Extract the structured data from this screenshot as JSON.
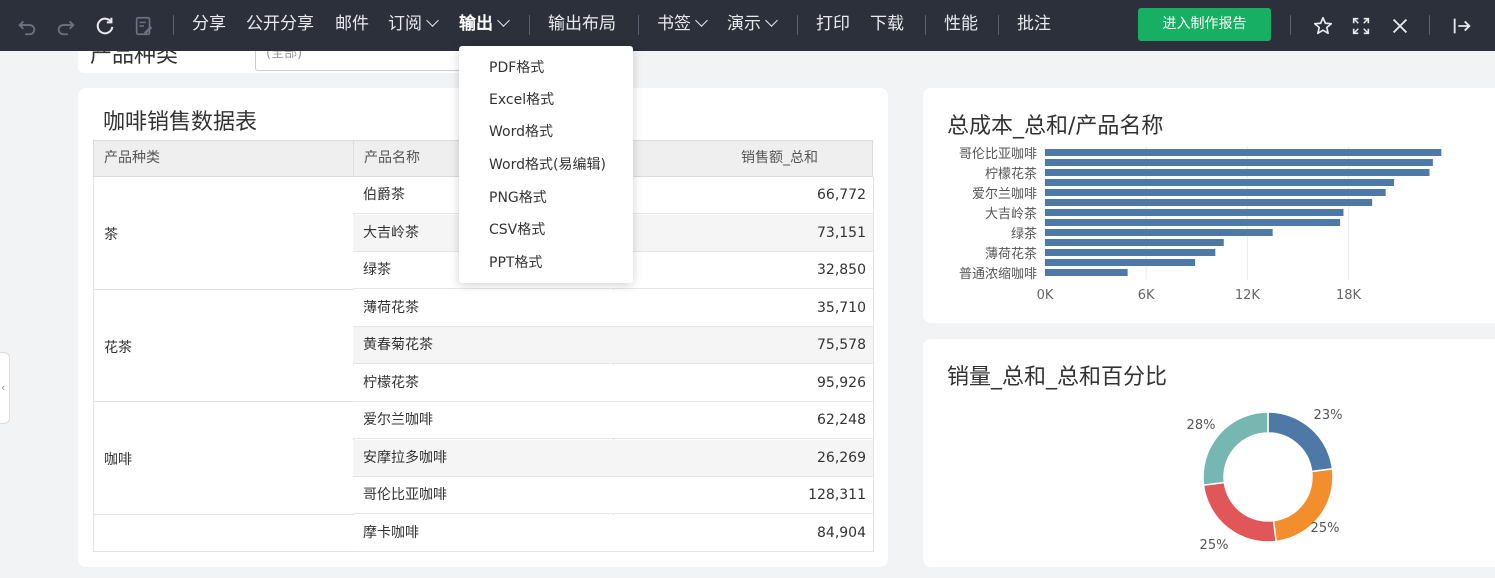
{
  "toolbar": {
    "items": [
      "分享",
      "公开分享",
      "邮件",
      "订阅",
      "输出",
      "输出布局",
      "书签",
      "演示",
      "打印",
      "下载",
      "性能",
      "批注"
    ],
    "active_index": 4,
    "cta_label": "进入制作报告"
  },
  "filter": {
    "label": "产品种类",
    "value": "(全部)"
  },
  "export_menu": {
    "items": [
      "PDF格式",
      "Excel格式",
      "Word格式",
      "Word格式(易编辑)",
      "PNG格式",
      "CSV格式",
      "PPT格式"
    ]
  },
  "sales_table": {
    "title": "咖啡销售数据表",
    "headers": [
      "产品种类",
      "产品名称",
      "",
      "销售额_总和"
    ],
    "groups": [
      {
        "category": "茶",
        "rows": [
          {
            "name": "伯爵茶",
            "value": "66,772"
          },
          {
            "name": "大吉岭茶",
            "value": "73,151"
          },
          {
            "name": "绿茶",
            "value": "32,850"
          }
        ]
      },
      {
        "category": "花茶",
        "rows": [
          {
            "name": "薄荷花茶",
            "value": "35,710"
          },
          {
            "name": "黄春菊花茶",
            "value": "75,578"
          },
          {
            "name": "柠檬花茶",
            "value": "95,926"
          }
        ]
      },
      {
        "category": "咖啡",
        "rows": [
          {
            "name": "爱尔兰咖啡",
            "value": "62,248"
          },
          {
            "name": "安摩拉多咖啡",
            "value": "26,269"
          },
          {
            "name": "哥伦比亚咖啡",
            "value": "128,311"
          }
        ]
      },
      {
        "category": "",
        "rows": [
          {
            "name": "摩卡咖啡",
            "value": "84,904"
          }
        ]
      }
    ]
  },
  "chart_data": [
    {
      "type": "bar",
      "orientation": "horizontal",
      "title": "总成本_总和/产品名称",
      "categories": [
        "哥伦比亚咖啡",
        "",
        "柠檬花茶",
        "",
        "爱尔兰咖啡",
        "",
        "大吉岭茶",
        "",
        "绿茶",
        "",
        "薄荷花茶",
        "",
        "普通浓缩咖啡"
      ],
      "values": [
        23500,
        23000,
        22800,
        20700,
        20200,
        19400,
        17700,
        17500,
        13500,
        10600,
        10100,
        8900,
        4900
      ],
      "xticks": [
        "0K",
        "6K",
        "12K",
        "18K"
      ],
      "xlim": [
        0,
        22000
      ],
      "grid": true,
      "bar_color": "#4e79a7"
    },
    {
      "type": "pie",
      "style": "donut",
      "title": "销量_总和_总和百分比",
      "slices": [
        {
          "label": "23%",
          "value": 23,
          "color": "#4e79a7"
        },
        {
          "label": "25%",
          "value": 25,
          "color": "#f28e2b"
        },
        {
          "label": "25%",
          "value": 25,
          "color": "#e15759"
        },
        {
          "label": "28%",
          "value": 27,
          "color": "#76b7b2"
        }
      ]
    }
  ]
}
